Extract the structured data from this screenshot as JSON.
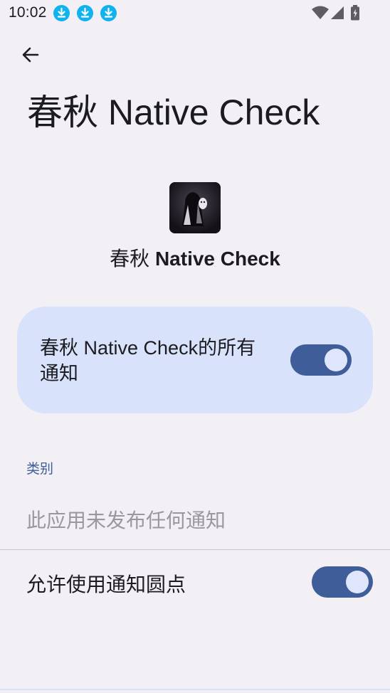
{
  "status_bar": {
    "time": "10:02",
    "notification_icons": [
      "download-icon",
      "download-icon",
      "download-icon"
    ],
    "right_icons": [
      "wifi-icon",
      "signal-icon",
      "battery-charging-icon"
    ]
  },
  "header": {
    "back_icon": "arrow-back-icon",
    "title": "春秋 Native Check"
  },
  "app": {
    "name_prefix": "春秋 ",
    "name_bold": "Native Check"
  },
  "master_switch": {
    "label": "春秋 Native Check的所有通知",
    "enabled": true
  },
  "categories": {
    "header": "类别",
    "empty_text": "此应用未发布任何通知"
  },
  "dots_setting": {
    "label": "允许使用通知圆点",
    "enabled": true
  },
  "colors": {
    "background": "#f3f0f5",
    "card": "#d8e2fb",
    "accent": "#3f5d99",
    "download_badge": "#10b2f0"
  }
}
